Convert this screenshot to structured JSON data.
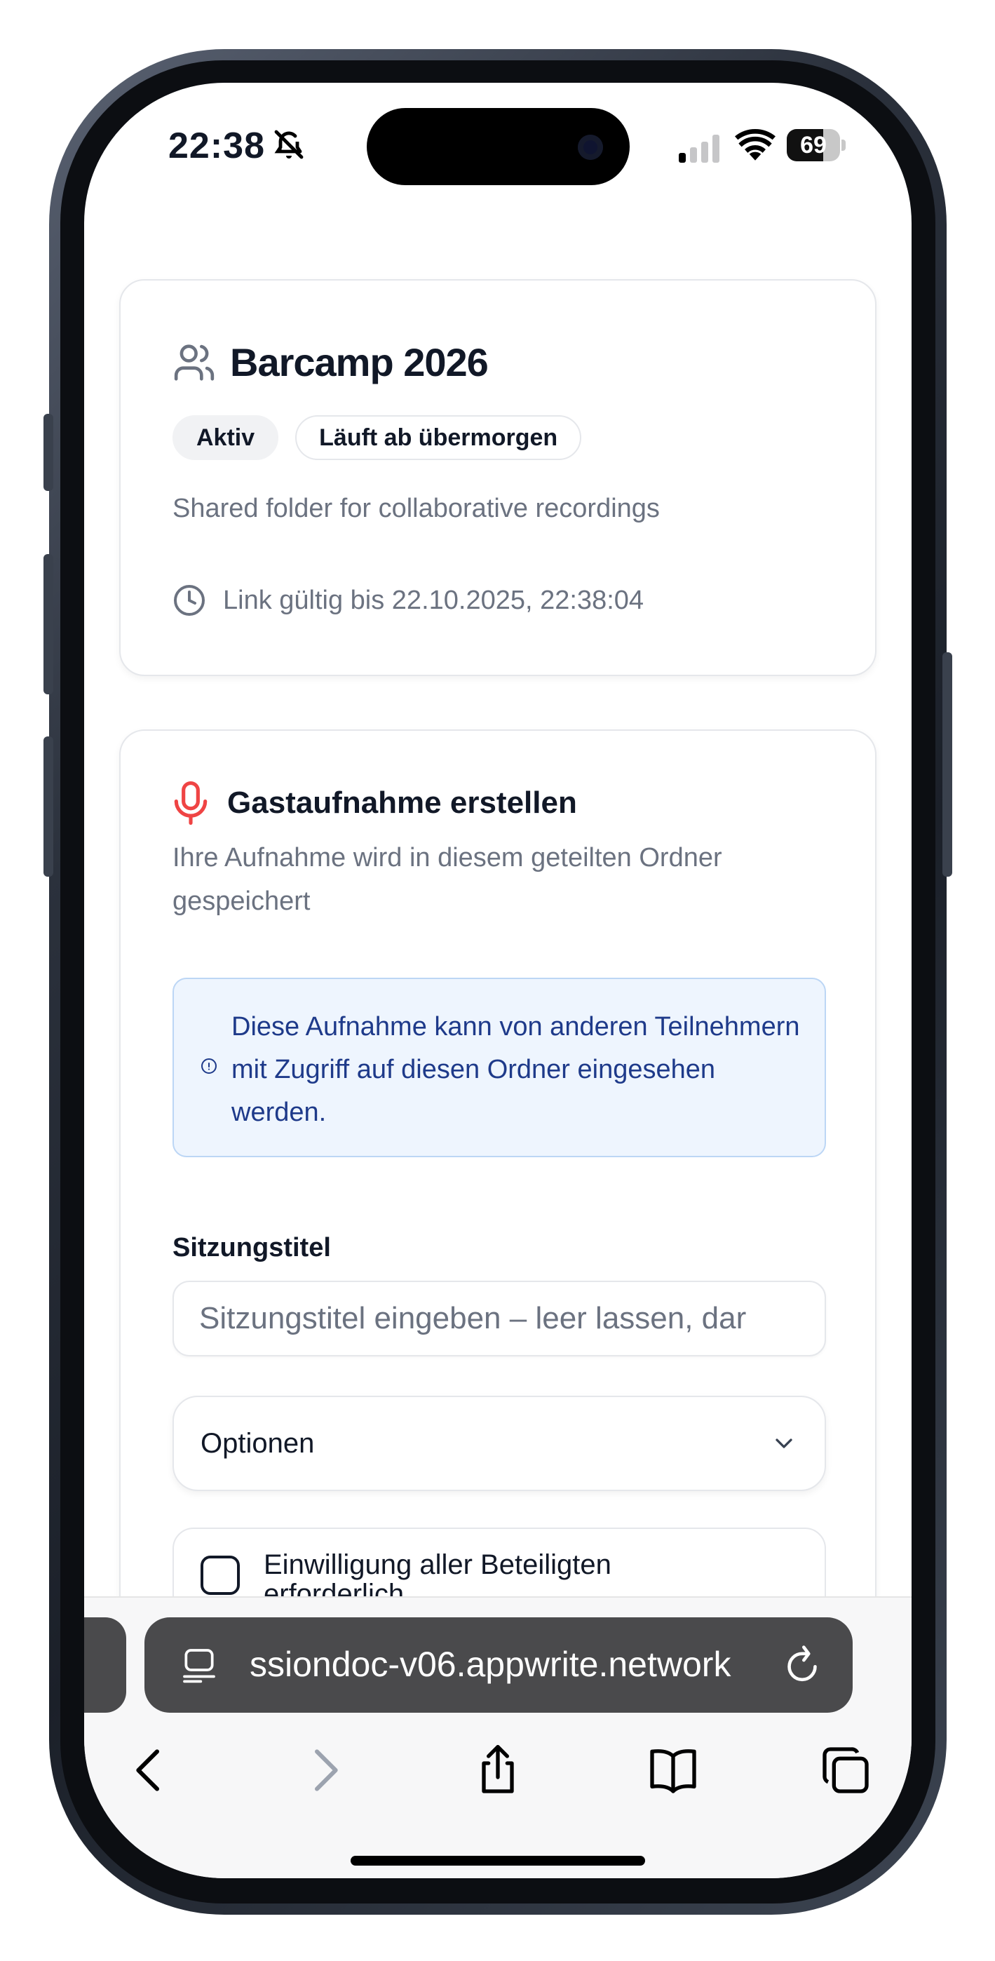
{
  "status_bar": {
    "time": "22:38",
    "battery": "69",
    "battery_level": 0.69
  },
  "session_card": {
    "title": "Barcamp 2026",
    "badge_status": "Aktiv",
    "badge_expiry": "Läuft ab übermorgen",
    "description": "Shared folder for collaborative recordings",
    "valid_until": "Link gültig bis 22.10.2025, 22:38:04"
  },
  "recording_card": {
    "title": "Gastaufnahme erstellen",
    "description": "Ihre Aufnahme wird in diesem geteilten Ordner gespeichert",
    "notice": "Diese Aufnahme kann von anderen Teilnehmern mit Zugriff auf diesen Ordner eingesehen werden.",
    "session_title_label": "Sitzungstitel",
    "session_title_placeholder": "Sitzungstitel eingeben – leer lassen, dar",
    "session_title_value": "",
    "options_label": "Optionen",
    "consent_label": "Einwilligung aller Beteiligten erforderlich",
    "consent_checked": false
  },
  "browser": {
    "url": "ssiondoc-v06.appwrite.network"
  },
  "colors": {
    "mic_icon": "#ef4444",
    "notice_bg": "#eef5fe",
    "notice_text": "#1e3a8a"
  }
}
